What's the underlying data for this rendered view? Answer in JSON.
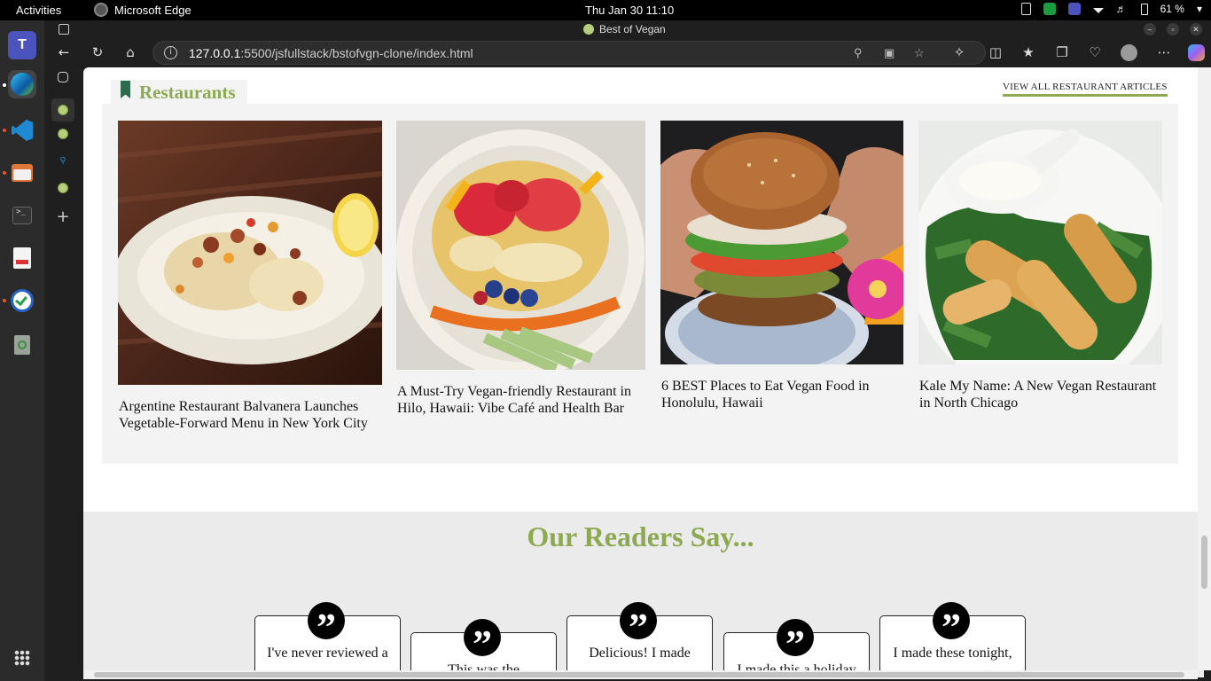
{
  "system_bar": {
    "activities": "Activities",
    "app_name": "Microsoft Edge",
    "clock": "Thu Jan 30  11:10",
    "battery": "61 %"
  },
  "browser": {
    "tab_title": "Best of Vegan",
    "url_host": "127.0.0.1",
    "url_rest": ":5500/jsfullstack/bstofvgn-clone/index.html"
  },
  "restaurants": {
    "heading": "Restaurants",
    "view_all": "VIEW ALL RESTAURANT ARTICLES",
    "cards": [
      {
        "caption": "Argentine Restaurant Balvanera Launches Vegetable-Forward Menu in New York City",
        "image": "roasted-cauliflower-plate"
      },
      {
        "caption": "A Must-Try Vegan-friendly Restaurant in Hilo, Hawaii: Vibe Café and Health Bar",
        "image": "fruit-bowl"
      },
      {
        "caption": "6 BEST Places to Eat Vegan Food in Honolulu, Hawaii",
        "image": "vegan-burger"
      },
      {
        "caption": "Kale My Name: A New Vegan Restaurant in North Chicago",
        "image": "fried-rolls-with-dip"
      }
    ]
  },
  "readers": {
    "heading": "Our Readers Say...",
    "quotes": [
      {
        "text": "I've never reviewed a"
      },
      {
        "text": "This was the"
      },
      {
        "text": "Delicious! I made"
      },
      {
        "text": "I made this a holiday"
      },
      {
        "text": "I made these tonight,"
      }
    ]
  },
  "colors": {
    "accent_green": "#8daa53",
    "bookmark_green": "#2e6b4e",
    "section_bg": "#f3f3f3",
    "readers_bg": "#ebebeb"
  }
}
